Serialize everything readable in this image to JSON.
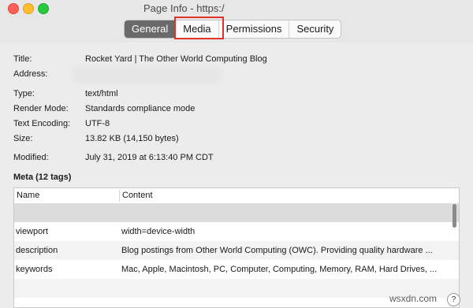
{
  "window": {
    "title": "Page Info - https:/"
  },
  "tabs": [
    {
      "label": "General",
      "active": true
    },
    {
      "label": "Media",
      "active": false
    },
    {
      "label": "Permissions",
      "active": false
    },
    {
      "label": "Security",
      "active": false
    }
  ],
  "info": {
    "title_label": "Title:",
    "title_value": "Rocket Yard | The Other World Computing Blog",
    "address_label": "Address:",
    "type_label": "Type:",
    "type_value": "text/html",
    "render_label": "Render Mode:",
    "render_value": "Standards compliance mode",
    "encoding_label": "Text Encoding:",
    "encoding_value": "UTF-8",
    "size_label": "Size:",
    "size_value": "13.82 KB (14,150 bytes)",
    "modified_label": "Modified:",
    "modified_value": "July 31, 2019 at 6:13:40 PM CDT"
  },
  "meta": {
    "heading": "Meta (12 tags)",
    "columns": [
      "Name",
      "Content"
    ],
    "rows": [
      {
        "name": "",
        "content": ""
      },
      {
        "name": "viewport",
        "content": "width=device-width"
      },
      {
        "name": "description",
        "content": "Blog postings from Other World Computing (OWC). Providing quality hardware ..."
      },
      {
        "name": "keywords",
        "content": "Mac, Apple, Macintosh, PC, Computer, Computing, Memory, RAM, Hard Drives, ..."
      }
    ]
  },
  "footer": {
    "help": "?",
    "watermark": "wsxdn.com"
  }
}
